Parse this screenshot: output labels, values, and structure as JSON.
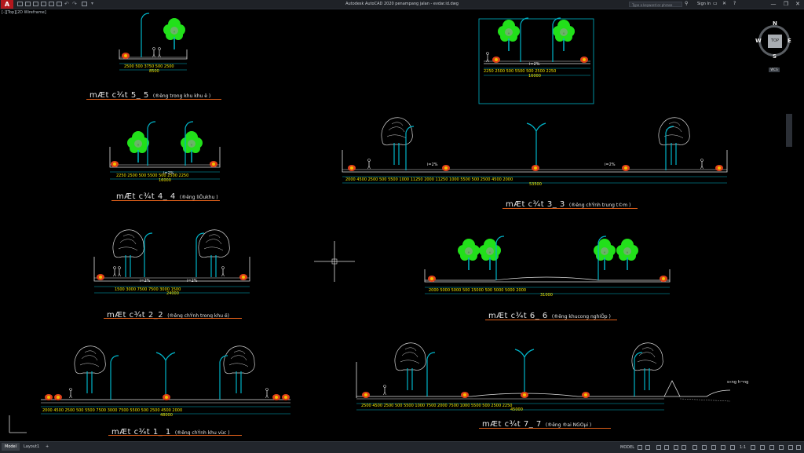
{
  "app": {
    "logo": "A",
    "title": "Autodesk AutoCAD 2020    penampang jalan - evdar.id.dwg",
    "search_placeholder": "Type a keyword or phrase",
    "sign_in": "Sign In",
    "window_buttons": [
      "—",
      "❐",
      "✕"
    ]
  },
  "viewport": {
    "label": "[-][Top][2D Wireframe]"
  },
  "viewcube": {
    "n": "N",
    "s": "S",
    "w": "W",
    "e": "E",
    "face": "TOP",
    "wcs": "WCS"
  },
  "sections": {
    "s55": {
      "title": "mÆt c¾t 5_ 5",
      "subtitle": "(®­êng trong khu khu ë )",
      "dims_top": "2500 500  3750  500 2500",
      "dims_bottom": "8500"
    },
    "s44": {
      "title": "mÆt c¾t 4_ 4",
      "subtitle": "(®­êng liÖukhu )",
      "dims_top": "2250   2500 500     5500     500 2500   2250",
      "dims_bottom": "16000"
    },
    "s22": {
      "title": "mÆt c¾t 2_2",
      "subtitle": "(®­êng chÝnh trong khu ë)",
      "dims_top": "1500  3000       7500        7500        3000  1500",
      "dims_bottom": "24000"
    },
    "s11": {
      "title": "mÆt c¾t 1_ 1",
      "subtitle": "(®­êng chÝnh khu vùc )",
      "dims_top": "2000    4500    2500 500    5500    7500    3000    7500    5500   500 2500   4500   2000",
      "dims_bottom": "48000"
    },
    "s33": {
      "title": "mÆt c¾t 3_ 3",
      "subtitle": "(®­êng chÝnh trung t©m )",
      "dims_top": "2000    4500   2500 500   5500    1000      11250      2000      11250     1000    5500   500 2500   4500   2000",
      "dims_bottom": "53500"
    },
    "s66": {
      "title": "mÆt c¾t 6_ 6",
      "subtitle": "(®­êng  khucong nghiÖp )",
      "dims_top": "2000   5000     5000   500       15000       500   5000    5000   2000",
      "dims_bottom": "31000"
    },
    "s77": {
      "title": "mÆt c¾t 7_ 7",
      "subtitle": "(®­êng ®ai NGOµi )",
      "dims_top": "2500    4500    2500 500   5500    1000    7500    2000    7500    1000   5500   500 2500   2250",
      "dims_bottom": "45000"
    },
    "smain": {
      "dims_top": "2250    2500 500      5500      500 2500    2250",
      "dims_bottom": "16000"
    }
  },
  "annotations": {
    "river": "s«ng h­¬ng",
    "slope": "i=2%"
  },
  "status": {
    "tabs": [
      "Model",
      "Layout1",
      "+"
    ],
    "model_label": "MODEL",
    "scale": "1:1"
  }
}
